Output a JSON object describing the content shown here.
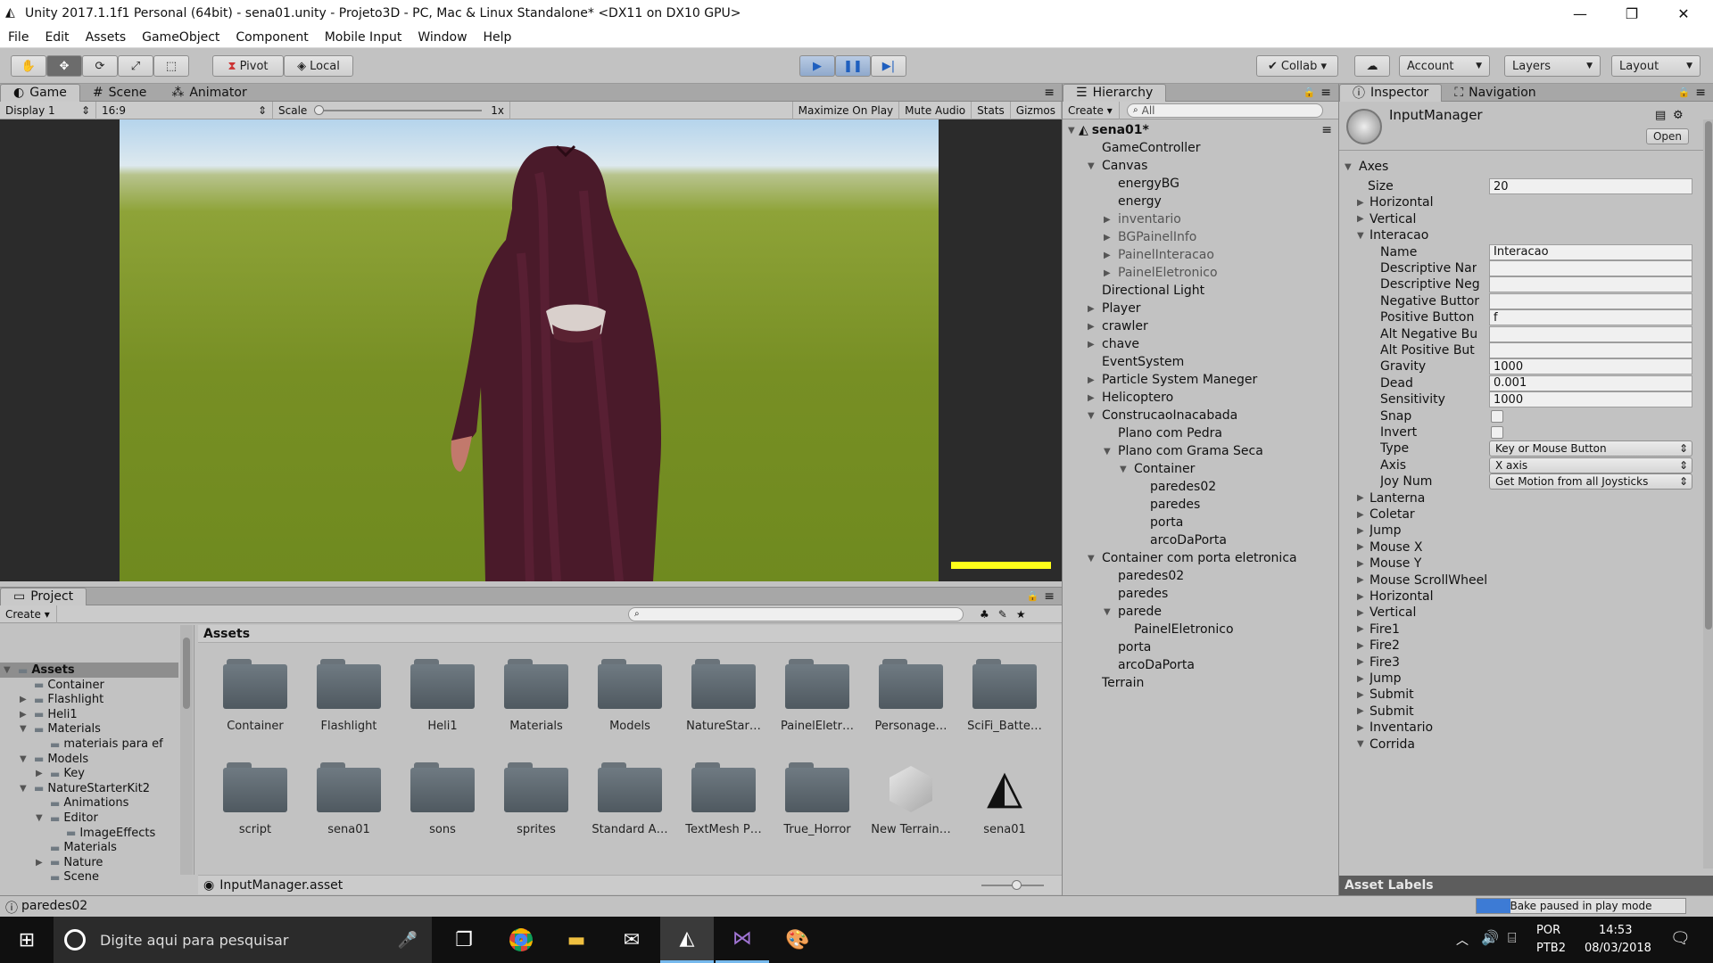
{
  "window": {
    "title": "Unity 2017.1.1f1 Personal (64bit) - sena01.unity - Projeto3D - PC, Mac & Linux Standalone* <DX11 on DX10 GPU>",
    "min": "—",
    "max": "❐",
    "close": "✕"
  },
  "menu": [
    "File",
    "Edit",
    "Assets",
    "GameObject",
    "Component",
    "Mobile Input",
    "Window",
    "Help"
  ],
  "toolbar": {
    "pivot": "Pivot",
    "local": "Local",
    "collab": "Collab ▾",
    "account": "Account",
    "layers": "Layers",
    "layout": "Layout"
  },
  "game": {
    "tabs": [
      "Game",
      "Scene",
      "Animator"
    ],
    "display": "Display 1",
    "aspect": "16:9",
    "scale_label": "Scale",
    "scale_value": "1x",
    "buttons": [
      "Maximize On Play",
      "Mute Audio",
      "Stats",
      "Gizmos"
    ],
    "health_fraction": 1.0
  },
  "hierarchy": {
    "tab": "Hierarchy",
    "create": "Create ▾",
    "search_placeholder": "All",
    "scene": "sena01*",
    "items": [
      {
        "label": "GameController",
        "depth": 1,
        "arrow": "",
        "dim": false
      },
      {
        "label": "Canvas",
        "depth": 1,
        "arrow": "▼",
        "dim": false
      },
      {
        "label": "energyBG",
        "depth": 2,
        "arrow": "",
        "dim": false
      },
      {
        "label": "energy",
        "depth": 2,
        "arrow": "",
        "dim": false
      },
      {
        "label": "inventario",
        "depth": 2,
        "arrow": "▶",
        "dim": true
      },
      {
        "label": "BGPainelInfo",
        "depth": 2,
        "arrow": "▶",
        "dim": true
      },
      {
        "label": "PainelInteracao",
        "depth": 2,
        "arrow": "▶",
        "dim": true
      },
      {
        "label": "PainelEletronico",
        "depth": 2,
        "arrow": "▶",
        "dim": true
      },
      {
        "label": "Directional Light",
        "depth": 1,
        "arrow": "",
        "dim": false
      },
      {
        "label": "Player",
        "depth": 1,
        "arrow": "▶",
        "dim": false
      },
      {
        "label": "crawler",
        "depth": 1,
        "arrow": "▶",
        "dim": false
      },
      {
        "label": "chave",
        "depth": 1,
        "arrow": "▶",
        "dim": false
      },
      {
        "label": "EventSystem",
        "depth": 1,
        "arrow": "",
        "dim": false
      },
      {
        "label": "Particle System Maneger",
        "depth": 1,
        "arrow": "▶",
        "dim": false
      },
      {
        "label": "Helicoptero",
        "depth": 1,
        "arrow": "▶",
        "dim": false
      },
      {
        "label": "ConstrucaoInacabada",
        "depth": 1,
        "arrow": "▼",
        "dim": false
      },
      {
        "label": "Plano com Pedra",
        "depth": 2,
        "arrow": "",
        "dim": false
      },
      {
        "label": "Plano com Grama Seca",
        "depth": 2,
        "arrow": "▼",
        "dim": false
      },
      {
        "label": "Container",
        "depth": 3,
        "arrow": "▼",
        "dim": false
      },
      {
        "label": "paredes02",
        "depth": 4,
        "arrow": "",
        "dim": false
      },
      {
        "label": "paredes",
        "depth": 4,
        "arrow": "",
        "dim": false
      },
      {
        "label": "porta",
        "depth": 4,
        "arrow": "",
        "dim": false
      },
      {
        "label": "arcoDaPorta",
        "depth": 4,
        "arrow": "",
        "dim": false
      },
      {
        "label": "Container com porta eletronica",
        "depth": 1,
        "arrow": "▼",
        "dim": false
      },
      {
        "label": "paredes02",
        "depth": 2,
        "arrow": "",
        "dim": false
      },
      {
        "label": "paredes",
        "depth": 2,
        "arrow": "",
        "dim": false
      },
      {
        "label": "parede",
        "depth": 2,
        "arrow": "▼",
        "dim": false
      },
      {
        "label": "PainelEletronico",
        "depth": 3,
        "arrow": "",
        "dim": false
      },
      {
        "label": "porta",
        "depth": 2,
        "arrow": "",
        "dim": false
      },
      {
        "label": "arcoDaPorta",
        "depth": 2,
        "arrow": "",
        "dim": false
      },
      {
        "label": "Terrain",
        "depth": 1,
        "arrow": "",
        "dim": false
      }
    ]
  },
  "inspector": {
    "tabs": [
      "Inspector",
      "Navigation"
    ],
    "object": "InputManager",
    "open_button": "Open",
    "axes_label": "Axes",
    "fields": [
      {
        "label": "Size",
        "kind": "text",
        "value": "20",
        "depth": 1
      },
      {
        "label": "Horizontal",
        "kind": "fold",
        "value": "",
        "depth": 1
      },
      {
        "label": "Vertical",
        "kind": "fold",
        "value": "",
        "depth": 1
      },
      {
        "label": "Interacao",
        "kind": "open",
        "value": "",
        "depth": 1
      },
      {
        "label": "Name",
        "kind": "text",
        "value": "Interacao",
        "depth": 2
      },
      {
        "label": "Descriptive Nar",
        "kind": "text",
        "value": "",
        "depth": 2
      },
      {
        "label": "Descriptive Neg",
        "kind": "text",
        "value": "",
        "depth": 2
      },
      {
        "label": "Negative Buttor",
        "kind": "text",
        "value": "",
        "depth": 2
      },
      {
        "label": "Positive Button",
        "kind": "text",
        "value": "f",
        "depth": 2
      },
      {
        "label": "Alt Negative Bu",
        "kind": "text",
        "value": "",
        "depth": 2
      },
      {
        "label": "Alt Positive But",
        "kind": "text",
        "value": "",
        "depth": 2
      },
      {
        "label": "Gravity",
        "kind": "text",
        "value": "1000",
        "depth": 2
      },
      {
        "label": "Dead",
        "kind": "text",
        "value": "0.001",
        "depth": 2
      },
      {
        "label": "Sensitivity",
        "kind": "text",
        "value": "1000",
        "depth": 2
      },
      {
        "label": "Snap",
        "kind": "check",
        "value": "",
        "depth": 2
      },
      {
        "label": "Invert",
        "kind": "check",
        "value": "",
        "depth": 2
      },
      {
        "label": "Type",
        "kind": "drop",
        "value": "Key or Mouse Button",
        "depth": 2
      },
      {
        "label": "Axis",
        "kind": "drop",
        "value": "X axis",
        "depth": 2
      },
      {
        "label": "Joy Num",
        "kind": "drop",
        "value": "Get Motion from all Joysticks",
        "depth": 2
      },
      {
        "label": "Lanterna",
        "kind": "fold",
        "value": "",
        "depth": 1
      },
      {
        "label": "Coletar",
        "kind": "fold",
        "value": "",
        "depth": 1
      },
      {
        "label": "Jump",
        "kind": "fold",
        "value": "",
        "depth": 1
      },
      {
        "label": "Mouse X",
        "kind": "fold",
        "value": "",
        "depth": 1
      },
      {
        "label": "Mouse Y",
        "kind": "fold",
        "value": "",
        "depth": 1
      },
      {
        "label": "Mouse ScrollWheel",
        "kind": "fold",
        "value": "",
        "depth": 1
      },
      {
        "label": "Horizontal",
        "kind": "fold",
        "value": "",
        "depth": 1
      },
      {
        "label": "Vertical",
        "kind": "fold",
        "value": "",
        "depth": 1
      },
      {
        "label": "Fire1",
        "kind": "fold",
        "value": "",
        "depth": 1
      },
      {
        "label": "Fire2",
        "kind": "fold",
        "value": "",
        "depth": 1
      },
      {
        "label": "Fire3",
        "kind": "fold",
        "value": "",
        "depth": 1
      },
      {
        "label": "Jump",
        "kind": "fold",
        "value": "",
        "depth": 1
      },
      {
        "label": "Submit",
        "kind": "fold",
        "value": "",
        "depth": 1
      },
      {
        "label": "Submit",
        "kind": "fold",
        "value": "",
        "depth": 1
      },
      {
        "label": "Inventario",
        "kind": "fold",
        "value": "",
        "depth": 1
      },
      {
        "label": "Corrida",
        "kind": "open",
        "value": "",
        "depth": 1
      }
    ],
    "asset_labels": "Asset Labels"
  },
  "project": {
    "tab": "Project",
    "create": "Create ▾",
    "tree": [
      {
        "label": "Assets",
        "depth": 0,
        "arrow": "▼"
      },
      {
        "label": "Container",
        "depth": 1,
        "arrow": ""
      },
      {
        "label": "Flashlight",
        "depth": 1,
        "arrow": "▶"
      },
      {
        "label": "Heli1",
        "depth": 1,
        "arrow": "▶"
      },
      {
        "label": "Materials",
        "depth": 1,
        "arrow": "▼"
      },
      {
        "label": "materiais para ef",
        "depth": 2,
        "arrow": ""
      },
      {
        "label": "Models",
        "depth": 1,
        "arrow": "▼"
      },
      {
        "label": "Key",
        "depth": 2,
        "arrow": "▶"
      },
      {
        "label": "NatureStarterKit2",
        "depth": 1,
        "arrow": "▼"
      },
      {
        "label": "Animations",
        "depth": 2,
        "arrow": ""
      },
      {
        "label": "Editor",
        "depth": 2,
        "arrow": "▼"
      },
      {
        "label": "ImageEffects",
        "depth": 3,
        "arrow": ""
      },
      {
        "label": "Materials",
        "depth": 2,
        "arrow": ""
      },
      {
        "label": "Nature",
        "depth": 2,
        "arrow": "▶"
      },
      {
        "label": "Scene",
        "depth": 2,
        "arrow": ""
      }
    ],
    "breadcrumb": "Assets",
    "assets_row1": [
      "Container",
      "Flashlight",
      "Heli1",
      "Materials",
      "Models",
      "NatureStar…",
      "PainelEletr…",
      "Personage…",
      "SciFi_Batte…"
    ],
    "assets_row2": [
      "script",
      "sena01",
      "sons",
      "sprites",
      "Standard A…",
      "TextMesh P…",
      "True_Horror",
      "New Terrain…",
      "sena01"
    ],
    "selected_asset": "InputManager.asset"
  },
  "status": {
    "left": "paredes02",
    "right": "Bake paused in play mode"
  },
  "taskbar": {
    "search": "Digite aqui para pesquisar",
    "lang1": "POR",
    "lang2": "PTB2",
    "time": "14:53",
    "date": "08/03/2018"
  }
}
